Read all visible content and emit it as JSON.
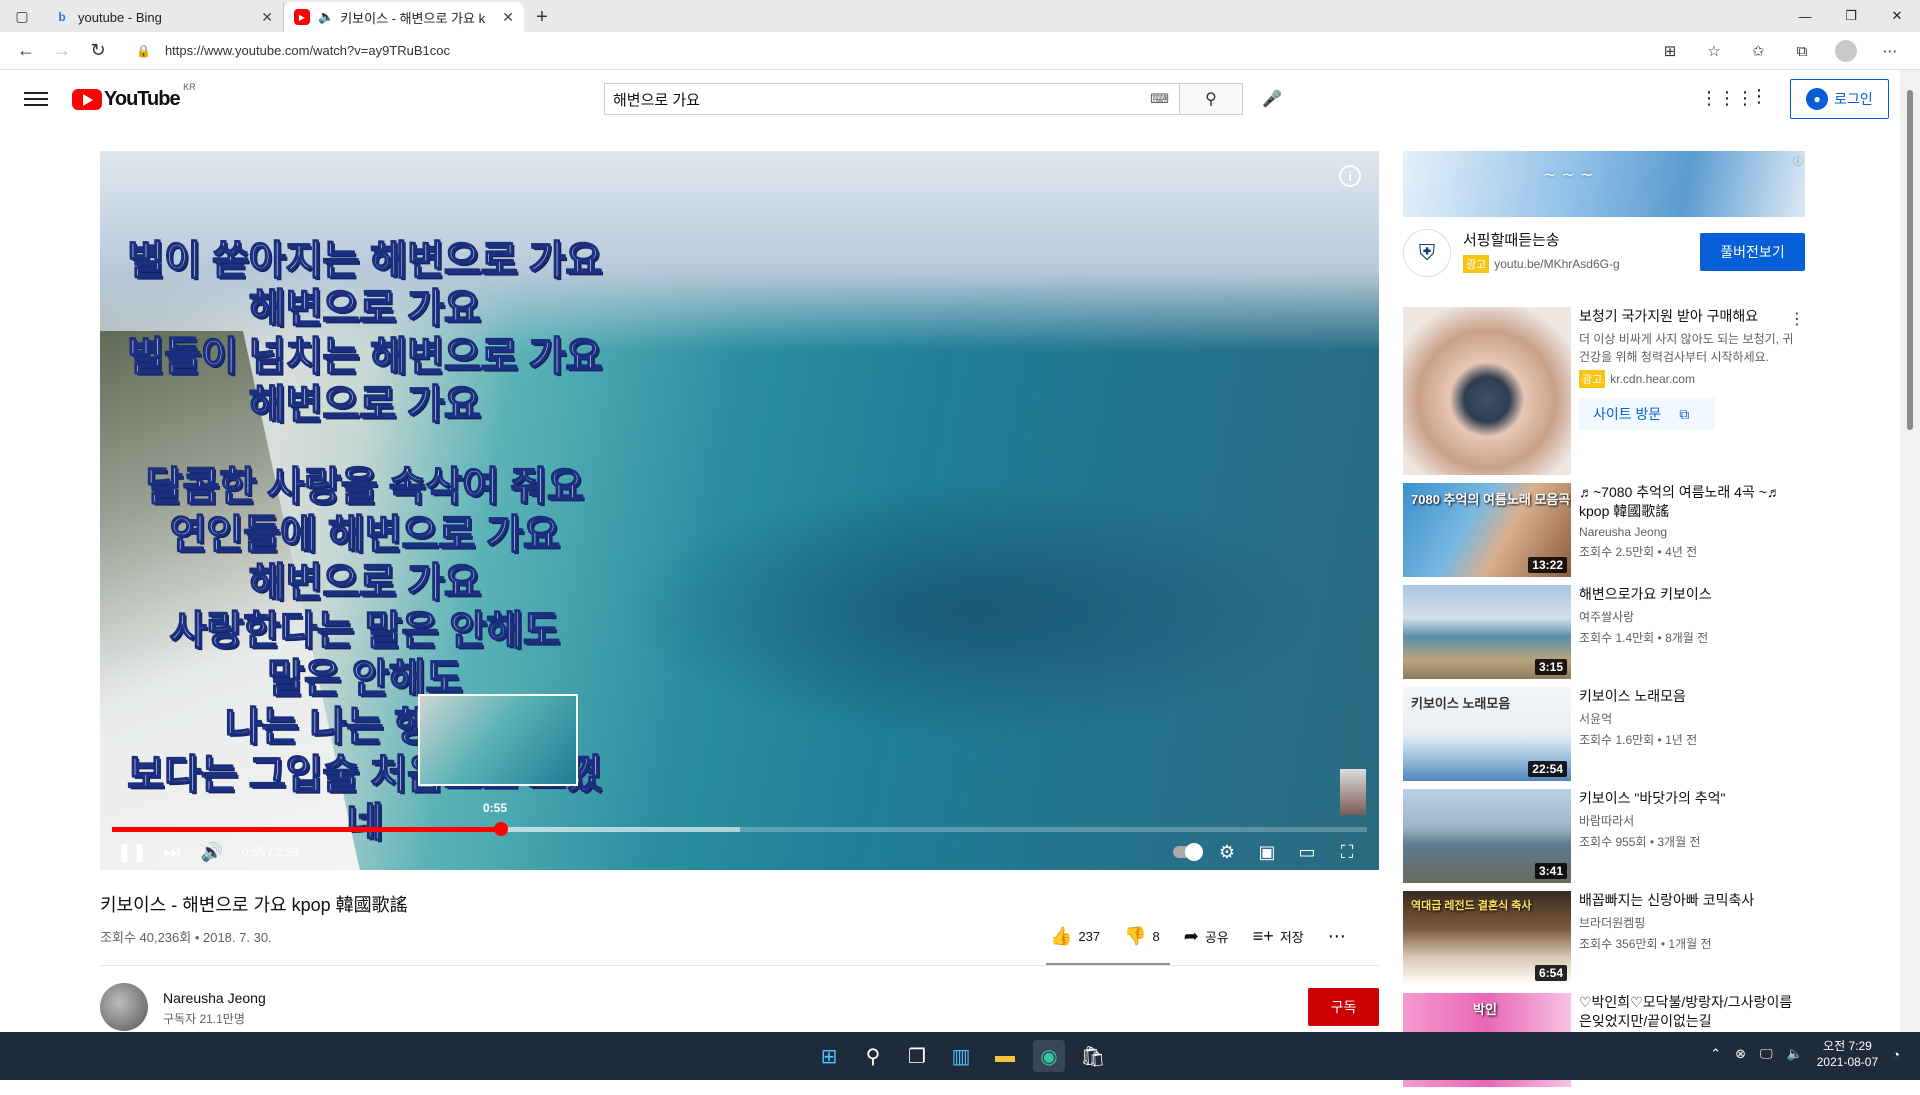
{
  "browser": {
    "tabs": [
      {
        "label": "youtube - Bing",
        "active": false
      },
      {
        "label": "키보이스 - 해변으로 가요 k",
        "active": true
      }
    ],
    "url": "https://www.youtube.com/watch?v=ay9TRuB1coc"
  },
  "youtube": {
    "logo_text": "YouTube",
    "region": "KR",
    "search_value": "해변으로 가요",
    "login_label": "로그인"
  },
  "player": {
    "lyrics": [
      "별이 쏟아지는 해변으로 가요",
      "해변으로 가요",
      "별들이 넘치는 해변으로 가요",
      "해변으로 가요",
      "",
      "달콤한 사랑을 속삭여 줘요",
      "연인들에 해변으로 가요",
      "해변으로 가요",
      "사랑한다는 말은 안해도",
      "말은 안해도",
      "나는 나는 행복에",
      "보다는 그입술 처음으로 느꼈네"
    ],
    "preview_time": "0:55",
    "time_display": "0:55 / 2:59",
    "progress_fraction": 0.31,
    "loaded_fraction": 0.5
  },
  "video": {
    "title": "키보이스 - 해변으로 가요 kpop 韓國歌謠",
    "views": "조회수 40,236회 • 2018. 7. 30.",
    "likes": "237",
    "dislikes": "8",
    "share_label": "공유",
    "save_label": "저장",
    "channel": "Nareusha Jeong",
    "subscribers": "구독자 21.1만명",
    "subscribe_label": "구독"
  },
  "sidebar": {
    "ad": {
      "title": "서핑할때듣는송",
      "badge": "광고",
      "url": "youtu.be/MKhrAsd6G-g",
      "button": "풀버전보기"
    },
    "promo": {
      "title": "보청기 국가지원 받아 구매해요",
      "desc": "더 이상 비싸게 사지 않아도 되는 보청기, 귀 건강을 위해 청력검사부터 시작하세요.",
      "badge": "광고",
      "url": "kr.cdn.hear.com",
      "visit": "사이트 방문"
    },
    "videos": [
      {
        "title": "♬~7080 추억의 여름노래 4곡 ~♬ kpop 韓國歌謠",
        "channel": "Nareusha Jeong",
        "meta": "조회수 2.5만회 • 4년 전",
        "duration": "13:22",
        "overlay": "7080 추억의 여름노래 모음곡"
      },
      {
        "title": "해변으로가요 키보이스",
        "channel": "여주쌀사랑",
        "meta": "조회수 1.4만회 • 8개월 전",
        "duration": "3:15",
        "overlay": ""
      },
      {
        "title": "키보이스 노래모음",
        "channel": "서윤억",
        "meta": "조회수 1.6만회 • 1년 전",
        "duration": "22:54",
        "overlay": "키보이스 노래모음"
      },
      {
        "title": "키보이스 \"바닷가의 추억\"",
        "channel": "바람따라서",
        "meta": "조회수 955회 • 3개월 전",
        "duration": "3:41",
        "overlay": ""
      },
      {
        "title": "배꼽빠지는 신랑아빠 코믹축사",
        "channel": "브라더원켐핑",
        "meta": "조회수 356만회 • 1개월 전",
        "duration": "6:54",
        "overlay": "역대급 레전드 결혼식 축사"
      },
      {
        "title": "♡박인희♡모닥불/방랑자/그사랑이름은잊었지만/끝이없는길",
        "channel": "",
        "meta": "",
        "duration": "",
        "overlay": "박인"
      }
    ]
  },
  "taskbar": {
    "time": "오전 7:29",
    "date": "2021-08-07"
  },
  "colors": {
    "youtube_red": "#ff0000",
    "link_blue": "#065fd4",
    "subscribe_red": "#cc0000"
  }
}
